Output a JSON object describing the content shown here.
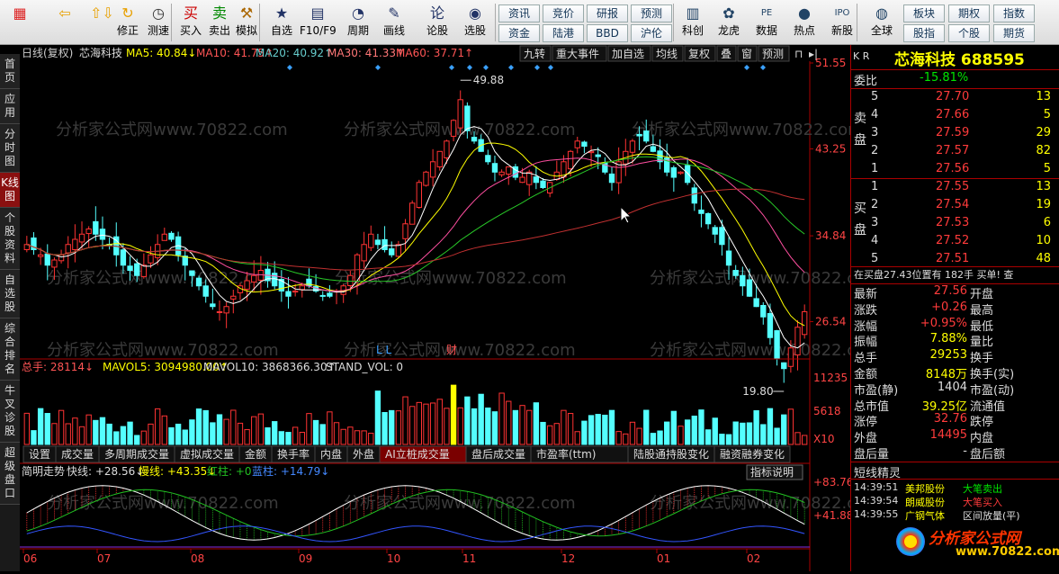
{
  "toolbar": {
    "items": [
      {
        "label": "",
        "icon": "home-icon",
        "glyph": "▦"
      },
      {
        "label": "",
        "icon": "back-icon",
        "glyph": "⇦"
      },
      {
        "label": "",
        "icon": "scroll-icon",
        "glyph": "⇧⇩"
      },
      {
        "label": "修正",
        "icon": "refresh-icon",
        "glyph": "↻"
      },
      {
        "label": "测速",
        "icon": "clock-icon",
        "glyph": "◷"
      },
      {
        "label": "买入",
        "icon": "buy-icon",
        "glyph": "买"
      },
      {
        "label": "卖出",
        "icon": "sell-icon",
        "glyph": "卖"
      },
      {
        "label": "模拟",
        "icon": "hammer-icon",
        "glyph": "⚒"
      },
      {
        "label": "自选",
        "icon": "star-icon",
        "glyph": "★"
      },
      {
        "label": "F10/F9",
        "icon": "f10-icon",
        "glyph": "▤"
      },
      {
        "label": "周期",
        "icon": "period-icon",
        "glyph": "◔"
      },
      {
        "label": "画线",
        "icon": "pen-icon",
        "glyph": "✎"
      },
      {
        "label": "论股",
        "icon": "discuss-icon",
        "glyph": "论"
      },
      {
        "label": "选股",
        "icon": "select-stock-icon",
        "glyph": "◉"
      }
    ],
    "small_buttons": [
      "资讯",
      "资金",
      "竞价",
      "陆港",
      "研报",
      "BBD",
      "预测",
      "沪伦"
    ],
    "items2": [
      {
        "label": "科创",
        "icon": "science-icon",
        "glyph": "▥"
      },
      {
        "label": "龙虎",
        "icon": "dragon-icon",
        "glyph": "✿"
      },
      {
        "label": "数据",
        "icon": "pe-icon",
        "glyph": "PE"
      },
      {
        "label": "热点",
        "icon": "hot-icon",
        "glyph": "●"
      },
      {
        "label": "新股",
        "icon": "ipo-icon",
        "glyph": "IPO"
      },
      {
        "label": "全球",
        "icon": "globe-icon",
        "glyph": "◍"
      }
    ],
    "small_buttons2": [
      "板块",
      "股指",
      "期权",
      "个股",
      "指数",
      "期货"
    ]
  },
  "left_tabs": [
    "首页",
    "应用",
    "分时图",
    "K线图",
    "个股资料",
    "自选股",
    "综合排名",
    "牛叉诊股",
    "超级盘口"
  ],
  "main": {
    "header": {
      "type": "日线(复权)",
      "name": "芯海科技",
      "ma5": "MA5: 40.84↓",
      "ma10": "MA10: 41.75↑",
      "ma20": "MA20: 40.92↑",
      "ma30": "MA30: 41.33↑",
      "ma60": "MA60: 37.71↑"
    },
    "header_buttons": [
      "九转",
      "重大事件",
      "加自选",
      "均线",
      "复权",
      "叠",
      "窗",
      "预测"
    ],
    "price_axis": [
      "51.55",
      "43.25",
      "34.84",
      "26.54"
    ],
    "high_label": "49.88",
    "low_label": "19.80",
    "markers": {
      "ll": "L L",
      "cai": "财"
    },
    "volume_header": {
      "label": "总手: 28114↓",
      "mavol5": "MAVOL5: 3094980.00↑",
      "mavol10": "MAVOL10: 3868366.30↑",
      "stand": "STAND_VOL: 0"
    },
    "volume_axis": [
      "11235",
      "5618",
      "X10"
    ],
    "sub_tabs": [
      "设置",
      "成交量",
      "多周期成交量",
      "虚拟成交量",
      "金额",
      "换手率",
      "内盘",
      "外盘",
      "AI立桩成交量",
      "盘后成交量",
      "市盈率(ttm)",
      "陆股通持股变化",
      "融资融券变化"
    ],
    "ind_header": {
      "name": "简明走势",
      "fast": "快线: +28.56↓",
      "slow": "慢线: +43.35↓",
      "red": "红柱: +0",
      "blue": "蓝柱: +14.79↓"
    },
    "ind_button": "指标说明",
    "ind_axis": [
      "+83.76",
      "+41.88"
    ],
    "x_axis": [
      "06",
      "07",
      "08",
      "09",
      "10",
      "11",
      "12",
      "01",
      "02"
    ],
    "watermark": "分析家公式网www.70822.com"
  },
  "chart_data": {
    "type": "candlestick",
    "title": "芯海科技 日线(复权)",
    "ylim": [
      19.8,
      51.55
    ],
    "high": 49.88,
    "low": 19.8,
    "close_path": [
      34,
      33.5,
      33,
      32,
      32.5,
      33,
      34,
      34.5,
      35,
      35.5,
      35,
      34.5,
      34,
      33,
      32,
      31.5,
      31,
      32,
      33,
      34,
      35,
      34.5,
      33,
      32,
      31,
      30,
      29,
      28,
      27.5,
      28,
      29,
      30,
      30.5,
      31,
      31.5,
      30.5,
      30,
      29.5,
      29,
      29.5,
      30,
      30,
      29.5,
      29,
      29,
      29.5,
      30,
      31,
      33,
      34,
      35,
      34,
      33.5,
      33,
      34,
      36,
      38,
      40,
      41,
      42,
      43,
      44,
      46,
      48,
      45,
      44,
      43,
      42,
      41,
      41,
      41.5,
      40.5,
      40.5,
      41,
      40,
      39.5,
      40,
      41,
      42,
      43,
      44,
      43.5,
      43,
      42.5,
      41,
      40,
      42,
      43,
      44,
      44.5,
      44,
      43,
      42,
      41,
      40.5,
      41,
      40,
      38,
      37,
      36,
      35,
      34,
      32,
      31,
      30,
      29,
      28,
      27,
      25,
      23,
      22,
      24,
      26,
      27.5
    ]
  },
  "right": {
    "stock_title": "芯海科技 688595",
    "webi": {
      "label": "委比",
      "value": "-15.81%"
    },
    "sell": [
      {
        "n": "5",
        "p": "27.70",
        "v": "13"
      },
      {
        "n": "4",
        "p": "27.66",
        "v": "5"
      },
      {
        "n": "3",
        "p": "27.59",
        "v": "29"
      },
      {
        "n": "2",
        "p": "27.57",
        "v": "82"
      },
      {
        "n": "1",
        "p": "27.56",
        "v": "5"
      }
    ],
    "buy": [
      {
        "n": "1",
        "p": "27.55",
        "v": "13"
      },
      {
        "n": "2",
        "p": "27.54",
        "v": "19"
      },
      {
        "n": "3",
        "p": "27.53",
        "v": "6"
      },
      {
        "n": "4",
        "p": "27.52",
        "v": "10"
      },
      {
        "n": "5",
        "p": "27.51",
        "v": "48"
      }
    ],
    "sell_label": "卖盘",
    "buy_label": "买盘",
    "pos_line": "在买盘27.43位置有  182手  买单!  查",
    "kr": "K R",
    "stats": [
      {
        "k": "最新",
        "v": "27.56",
        "k2": "开盘",
        "c": "red"
      },
      {
        "k": "涨跌",
        "v": "+0.26",
        "k2": "最高",
        "c": "red"
      },
      {
        "k": "涨幅",
        "v": "+0.95%",
        "k2": "最低",
        "c": "red"
      },
      {
        "k": "振幅",
        "v": "7.88%",
        "k2": "量比",
        "c": "yel"
      },
      {
        "k": "总手",
        "v": "29253",
        "k2": "换手",
        "c": "yel"
      },
      {
        "k": "金额",
        "v": "8148万",
        "k2": "换手(实)",
        "c": "yel"
      },
      {
        "k": "市盈(静)",
        "v": "1404",
        "k2": "市盈(动)",
        "c": "wht"
      },
      {
        "k": "总市值",
        "v": "39.25亿",
        "k2": "流通值",
        "c": "yel"
      },
      {
        "k": "涨停",
        "v": "32.76",
        "k2": "跌停",
        "c": "red"
      },
      {
        "k": "外盘",
        "v": "14495",
        "k2": "内盘",
        "c": "red"
      },
      {
        "k": "盘后量",
        "v": "-",
        "k2": "盘后额",
        "c": "wht"
      }
    ],
    "elf_title": "短线精灵",
    "elf": [
      {
        "t": "14:39:51",
        "s": "美邦股份",
        "a": "大笔卖出"
      },
      {
        "t": "14:39:54",
        "s": "朗威股份",
        "a": "大笔买入"
      },
      {
        "t": "14:39:55",
        "s": "广钢气体",
        "a": "区间放量(平)"
      }
    ],
    "logo": "分析家公式网",
    "logo_url": "www.70822.com"
  }
}
